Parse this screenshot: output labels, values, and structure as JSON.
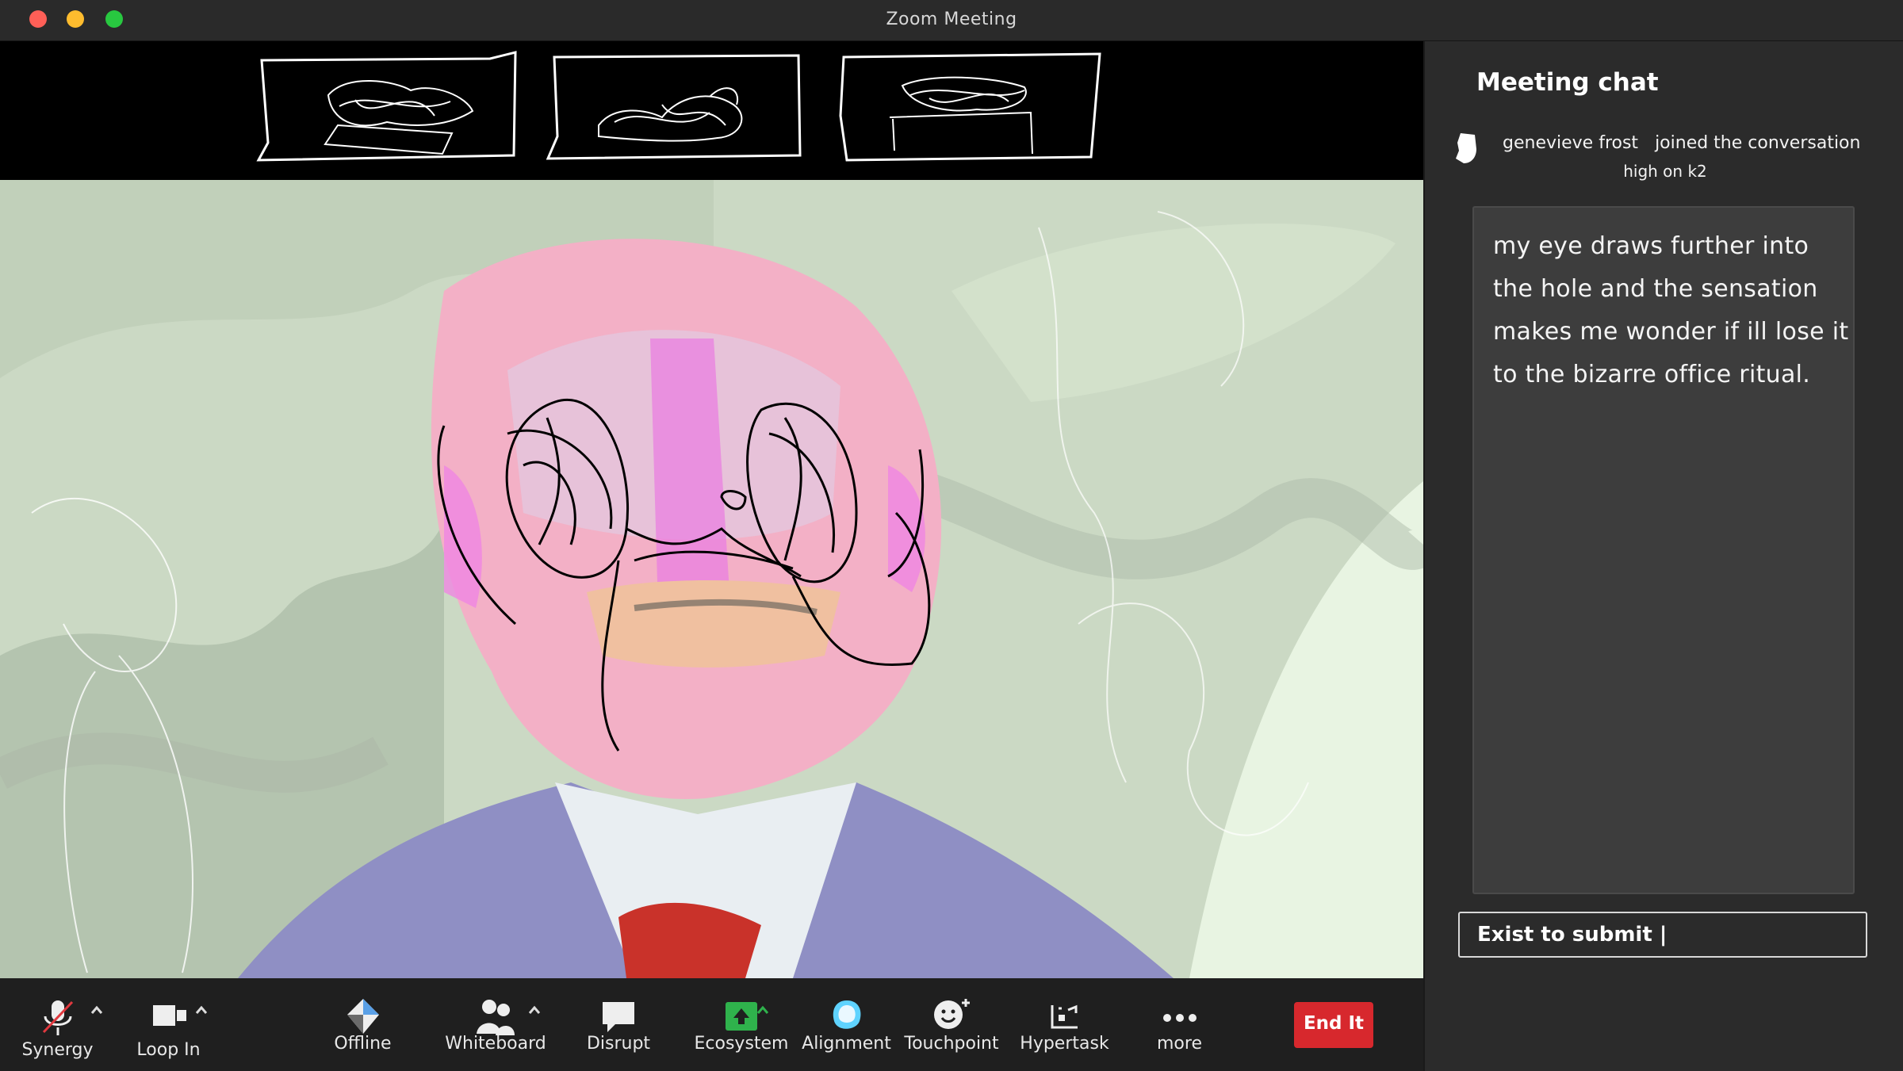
{
  "window": {
    "title": "Zoom Meeting"
  },
  "chat": {
    "title": "Meeting chat",
    "system_name": "genevieve frost",
    "system_action": "joined the conversation",
    "system_detail": "high on k2",
    "message": "my eye draws further into the hole and the sensation makes me wonder if ill lose it to the bizarre office ritual.",
    "input_value": "Exist to submit |"
  },
  "toolbar": {
    "items": [
      {
        "label": "Synergy",
        "icon": "muted-mic-icon"
      },
      {
        "label": "Loop In",
        "icon": "video-camera-icon"
      },
      {
        "label": "Offline",
        "icon": "security-shield-icon"
      },
      {
        "label": "Whiteboard",
        "icon": "participants-icon"
      },
      {
        "label": "Disrupt",
        "icon": "chat-bubble-icon"
      },
      {
        "label": "Ecosystem",
        "icon": "share-screen-icon"
      },
      {
        "label": "Alignment",
        "icon": "record-icon"
      },
      {
        "label": "Touchpoint",
        "icon": "reactions-icon"
      },
      {
        "label": "Hypertask",
        "icon": "apps-icon"
      },
      {
        "label": "more",
        "icon": "more-icon"
      }
    ],
    "end_label": "End It"
  },
  "colors": {
    "end_button": "#d7282d",
    "share_green": "#2fb24c",
    "alignment_blue": "#5fd3ff"
  }
}
